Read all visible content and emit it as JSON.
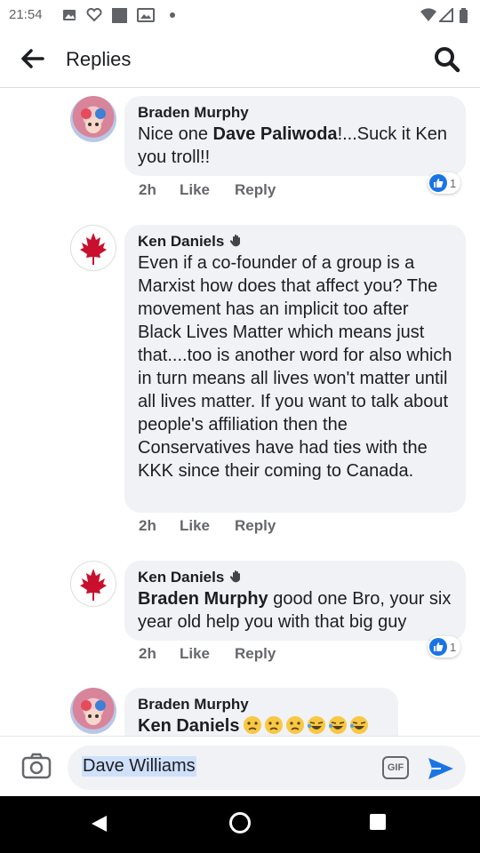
{
  "status": {
    "time": "21:54"
  },
  "header": {
    "title": "Replies"
  },
  "comments": [
    {
      "author": "Braden Murphy",
      "mention": "Dave Paliwoda",
      "text_before": "Nice one ",
      "text_after": "!...Suck it Ken you troll!!",
      "time": "2h",
      "like": "Like",
      "reply": "Reply",
      "reactions": "1"
    },
    {
      "author": "Ken Daniels",
      "text": "Even if a co-founder of a group is a Marxist how does that affect you? The movement has an implicit too after Black Lives Matter which means just that....too is another word for also which in turn means all lives won't matter until all lives matter. If you want to talk about people's affiliation then the Conservatives have had ties with the KKK since their coming to Canada.",
      "time": "2h",
      "like": "Like",
      "reply": "Reply"
    },
    {
      "author": "Ken Daniels",
      "mention": "Braden Murphy",
      "text_after": " good one Bro, your six year old help you with that big guy",
      "time": "2h",
      "like": "Like",
      "reply": "Reply",
      "reactions": "1"
    },
    {
      "author": "Braden Murphy",
      "mention": "Ken Daniels"
    }
  ],
  "composer": {
    "value": "Dave Williams",
    "gif_label": "GIF"
  },
  "colors": {
    "accent": "#1b74e4",
    "bubble": "#f0f2f5",
    "meta": "#65676b"
  }
}
